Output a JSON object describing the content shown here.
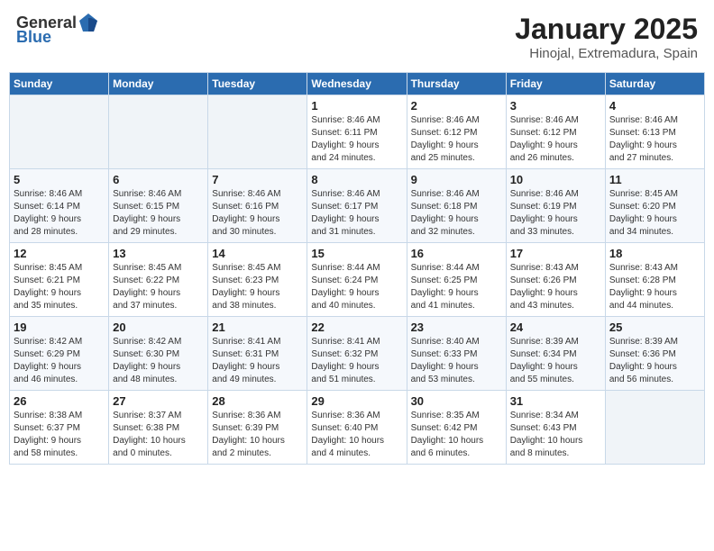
{
  "header": {
    "logo_general": "General",
    "logo_blue": "Blue",
    "title": "January 2025",
    "location": "Hinojal, Extremadura, Spain"
  },
  "weekdays": [
    "Sunday",
    "Monday",
    "Tuesday",
    "Wednesday",
    "Thursday",
    "Friday",
    "Saturday"
  ],
  "weeks": [
    [
      {
        "day": "",
        "info": ""
      },
      {
        "day": "",
        "info": ""
      },
      {
        "day": "",
        "info": ""
      },
      {
        "day": "1",
        "info": "Sunrise: 8:46 AM\nSunset: 6:11 PM\nDaylight: 9 hours\nand 24 minutes."
      },
      {
        "day": "2",
        "info": "Sunrise: 8:46 AM\nSunset: 6:12 PM\nDaylight: 9 hours\nand 25 minutes."
      },
      {
        "day": "3",
        "info": "Sunrise: 8:46 AM\nSunset: 6:12 PM\nDaylight: 9 hours\nand 26 minutes."
      },
      {
        "day": "4",
        "info": "Sunrise: 8:46 AM\nSunset: 6:13 PM\nDaylight: 9 hours\nand 27 minutes."
      }
    ],
    [
      {
        "day": "5",
        "info": "Sunrise: 8:46 AM\nSunset: 6:14 PM\nDaylight: 9 hours\nand 28 minutes."
      },
      {
        "day": "6",
        "info": "Sunrise: 8:46 AM\nSunset: 6:15 PM\nDaylight: 9 hours\nand 29 minutes."
      },
      {
        "day": "7",
        "info": "Sunrise: 8:46 AM\nSunset: 6:16 PM\nDaylight: 9 hours\nand 30 minutes."
      },
      {
        "day": "8",
        "info": "Sunrise: 8:46 AM\nSunset: 6:17 PM\nDaylight: 9 hours\nand 31 minutes."
      },
      {
        "day": "9",
        "info": "Sunrise: 8:46 AM\nSunset: 6:18 PM\nDaylight: 9 hours\nand 32 minutes."
      },
      {
        "day": "10",
        "info": "Sunrise: 8:46 AM\nSunset: 6:19 PM\nDaylight: 9 hours\nand 33 minutes."
      },
      {
        "day": "11",
        "info": "Sunrise: 8:45 AM\nSunset: 6:20 PM\nDaylight: 9 hours\nand 34 minutes."
      }
    ],
    [
      {
        "day": "12",
        "info": "Sunrise: 8:45 AM\nSunset: 6:21 PM\nDaylight: 9 hours\nand 35 minutes."
      },
      {
        "day": "13",
        "info": "Sunrise: 8:45 AM\nSunset: 6:22 PM\nDaylight: 9 hours\nand 37 minutes."
      },
      {
        "day": "14",
        "info": "Sunrise: 8:45 AM\nSunset: 6:23 PM\nDaylight: 9 hours\nand 38 minutes."
      },
      {
        "day": "15",
        "info": "Sunrise: 8:44 AM\nSunset: 6:24 PM\nDaylight: 9 hours\nand 40 minutes."
      },
      {
        "day": "16",
        "info": "Sunrise: 8:44 AM\nSunset: 6:25 PM\nDaylight: 9 hours\nand 41 minutes."
      },
      {
        "day": "17",
        "info": "Sunrise: 8:43 AM\nSunset: 6:26 PM\nDaylight: 9 hours\nand 43 minutes."
      },
      {
        "day": "18",
        "info": "Sunrise: 8:43 AM\nSunset: 6:28 PM\nDaylight: 9 hours\nand 44 minutes."
      }
    ],
    [
      {
        "day": "19",
        "info": "Sunrise: 8:42 AM\nSunset: 6:29 PM\nDaylight: 9 hours\nand 46 minutes."
      },
      {
        "day": "20",
        "info": "Sunrise: 8:42 AM\nSunset: 6:30 PM\nDaylight: 9 hours\nand 48 minutes."
      },
      {
        "day": "21",
        "info": "Sunrise: 8:41 AM\nSunset: 6:31 PM\nDaylight: 9 hours\nand 49 minutes."
      },
      {
        "day": "22",
        "info": "Sunrise: 8:41 AM\nSunset: 6:32 PM\nDaylight: 9 hours\nand 51 minutes."
      },
      {
        "day": "23",
        "info": "Sunrise: 8:40 AM\nSunset: 6:33 PM\nDaylight: 9 hours\nand 53 minutes."
      },
      {
        "day": "24",
        "info": "Sunrise: 8:39 AM\nSunset: 6:34 PM\nDaylight: 9 hours\nand 55 minutes."
      },
      {
        "day": "25",
        "info": "Sunrise: 8:39 AM\nSunset: 6:36 PM\nDaylight: 9 hours\nand 56 minutes."
      }
    ],
    [
      {
        "day": "26",
        "info": "Sunrise: 8:38 AM\nSunset: 6:37 PM\nDaylight: 9 hours\nand 58 minutes."
      },
      {
        "day": "27",
        "info": "Sunrise: 8:37 AM\nSunset: 6:38 PM\nDaylight: 10 hours\nand 0 minutes."
      },
      {
        "day": "28",
        "info": "Sunrise: 8:36 AM\nSunset: 6:39 PM\nDaylight: 10 hours\nand 2 minutes."
      },
      {
        "day": "29",
        "info": "Sunrise: 8:36 AM\nSunset: 6:40 PM\nDaylight: 10 hours\nand 4 minutes."
      },
      {
        "day": "30",
        "info": "Sunrise: 8:35 AM\nSunset: 6:42 PM\nDaylight: 10 hours\nand 6 minutes."
      },
      {
        "day": "31",
        "info": "Sunrise: 8:34 AM\nSunset: 6:43 PM\nDaylight: 10 hours\nand 8 minutes."
      },
      {
        "day": "",
        "info": ""
      }
    ]
  ]
}
